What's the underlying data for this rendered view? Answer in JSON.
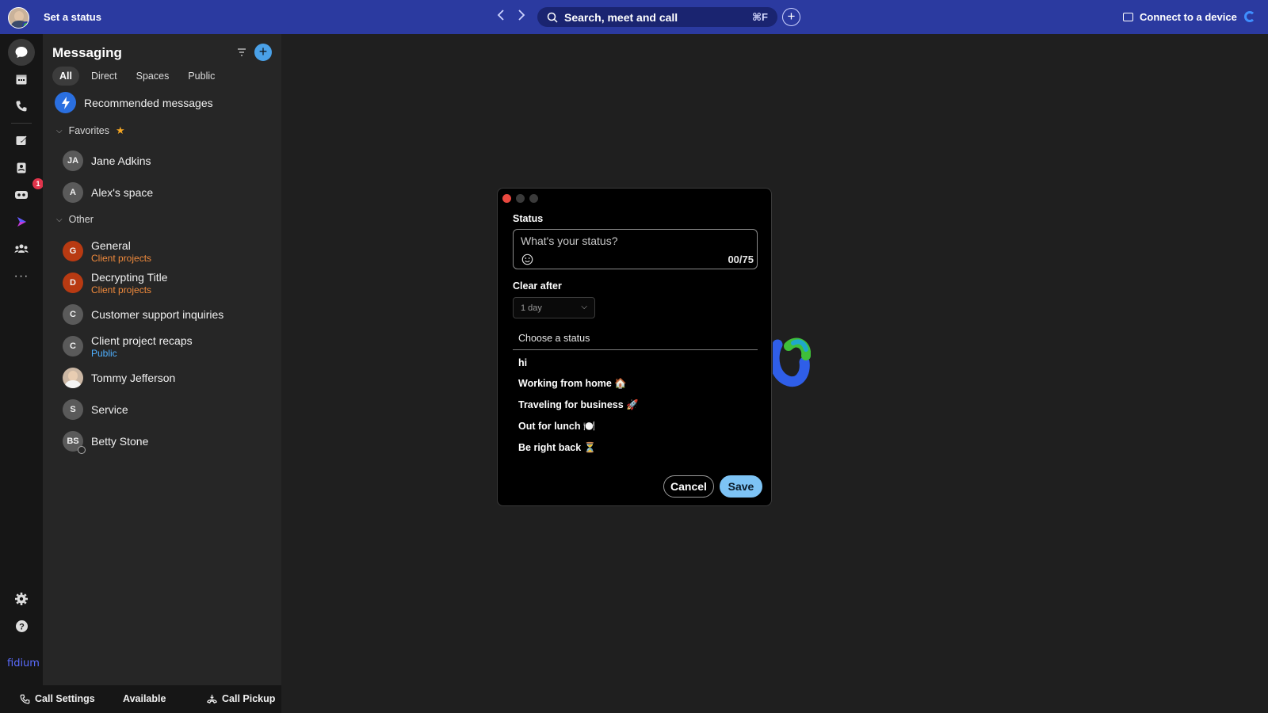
{
  "topbar": {
    "set_status": "Set a status",
    "search_placeholder": "Search, meet and call",
    "search_shortcut": "⌘F",
    "connect_label": "Connect to a device"
  },
  "rail": {
    "badge_count": "1",
    "logo_text": "fidium"
  },
  "messaging": {
    "title": "Messaging",
    "tabs": [
      "All",
      "Direct",
      "Spaces",
      "Public"
    ],
    "recommended": "Recommended messages",
    "favorites_label": "Favorites",
    "other_label": "Other",
    "favorites": [
      {
        "initials": "JA",
        "name": "Jane Adkins"
      },
      {
        "initials": "A",
        "name": "Alex's space"
      }
    ],
    "other": [
      {
        "initials": "G",
        "name": "General",
        "sub": "Client projects"
      },
      {
        "initials": "D",
        "name": "Decrypting Title",
        "sub": "Client projects"
      },
      {
        "initials": "C",
        "name": "Customer support inquiries"
      },
      {
        "initials": "C",
        "name": "Client project recaps",
        "sub": "Public"
      },
      {
        "initials": "",
        "name": "Tommy Jefferson"
      },
      {
        "initials": "S",
        "name": "Service"
      },
      {
        "initials": "BS",
        "name": "Betty Stone"
      }
    ]
  },
  "statusbar": {
    "call_settings": "Call Settings",
    "available": "Available",
    "call_pickup": "Call Pickup"
  },
  "dialog": {
    "status_label": "Status",
    "status_placeholder": "What's your status?",
    "counter": "00/75",
    "clear_after_label": "Clear after",
    "clear_after_value": "1 day",
    "choose_label": "Choose a status",
    "options": [
      "hi",
      "Working from home 🏠",
      "Traveling for business 🚀",
      "Out for lunch 🍽️",
      "Be right back ⏳"
    ],
    "cancel": "Cancel",
    "save": "Save"
  },
  "colors": {
    "topbar": "#2b3aa0",
    "accent": "#7dc3f5",
    "orange_sub": "#f08a3c",
    "blue_sub": "#4fb0ff"
  }
}
